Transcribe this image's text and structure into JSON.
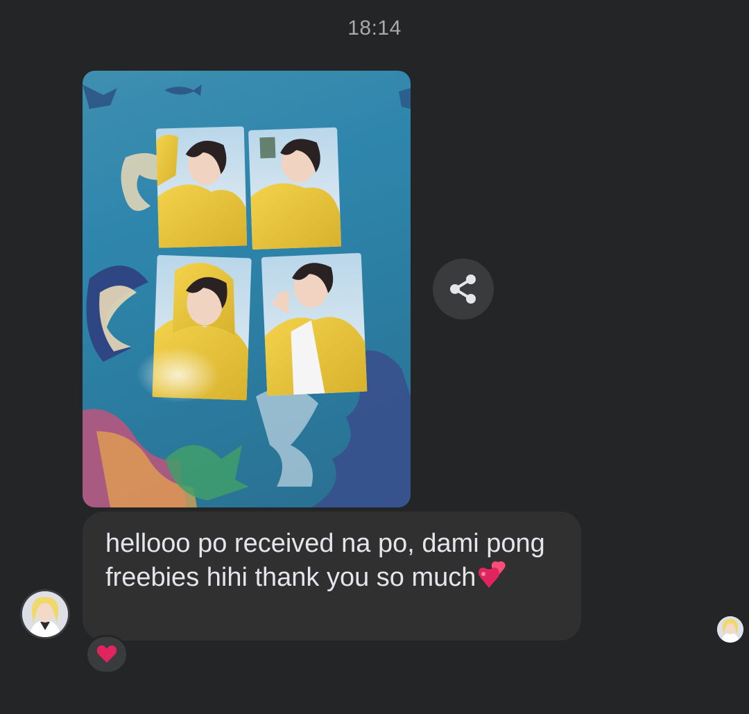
{
  "conversation": {
    "timestamp": "18:14"
  },
  "message": {
    "text": "hellooo po received na po, dami pong freebies hihi thank you so much",
    "emoji": "two-hearts-emoji",
    "reaction": "heart-reaction-icon"
  },
  "icons": {
    "share": "share-icon",
    "avatar": "user-avatar",
    "seen": "seen-avatar"
  },
  "colors": {
    "background": "#242526",
    "bubble": "#303030",
    "text": "#e4e6eb",
    "timestamp": "#a8a9ad",
    "heart": "#e0245e"
  }
}
